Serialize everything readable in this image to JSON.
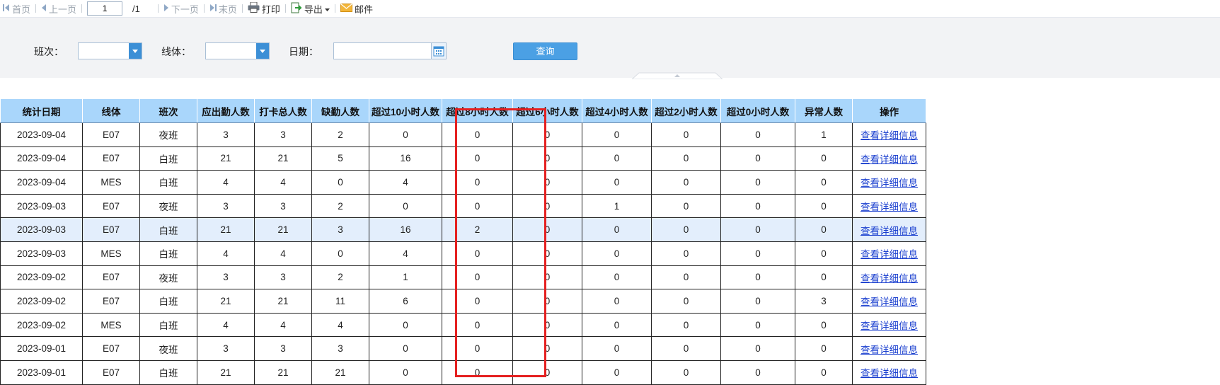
{
  "toolbar": {
    "first": "首页",
    "prev": "上一页",
    "page_value": "1",
    "page_total": "/1",
    "next": "下一页",
    "last": "末页",
    "print": "打印",
    "export": "导出",
    "mail": "邮件"
  },
  "filters": {
    "shift_label": "班次：",
    "line_label": "线体：",
    "date_label": "日期：",
    "query_button": "查询"
  },
  "colors": {
    "header_bg": "#a9d6fb",
    "accent": "#3c8fd6",
    "highlight_box": "#e52020",
    "selected_row": "#e3eefc"
  },
  "table": {
    "columns": [
      "统计日期",
      "线体",
      "班次",
      "应出勤人数",
      "打卡总人数",
      "缺勤人数",
      "超过10小时人数",
      "超过8小时人数",
      "超过6小时人数",
      "超过4小时人数",
      "超过2小时人数",
      "超过0小时人数",
      "异常人数",
      "操作"
    ],
    "action_label": "查看详细信息",
    "rows": [
      [
        "2023-09-04",
        "E07",
        "夜班",
        "3",
        "3",
        "2",
        "0",
        "0",
        "0",
        "0",
        "0",
        "0",
        "1"
      ],
      [
        "2023-09-04",
        "E07",
        "白班",
        "21",
        "21",
        "5",
        "16",
        "0",
        "0",
        "0",
        "0",
        "0",
        "0"
      ],
      [
        "2023-09-04",
        "MES",
        "白班",
        "4",
        "4",
        "0",
        "4",
        "0",
        "0",
        "0",
        "0",
        "0",
        "0"
      ],
      [
        "2023-09-03",
        "E07",
        "夜班",
        "3",
        "3",
        "2",
        "0",
        "0",
        "0",
        "1",
        "0",
        "0",
        "0"
      ],
      [
        "2023-09-03",
        "E07",
        "白班",
        "21",
        "21",
        "3",
        "16",
        "2",
        "0",
        "0",
        "0",
        "0",
        "0"
      ],
      [
        "2023-09-03",
        "MES",
        "白班",
        "4",
        "4",
        "0",
        "4",
        "0",
        "0",
        "0",
        "0",
        "0",
        "0"
      ],
      [
        "2023-09-02",
        "E07",
        "夜班",
        "3",
        "3",
        "2",
        "1",
        "0",
        "0",
        "0",
        "0",
        "0",
        "0"
      ],
      [
        "2023-09-02",
        "E07",
        "白班",
        "21",
        "21",
        "11",
        "6",
        "0",
        "0",
        "0",
        "0",
        "0",
        "3"
      ],
      [
        "2023-09-02",
        "MES",
        "白班",
        "4",
        "4",
        "4",
        "0",
        "0",
        "0",
        "0",
        "0",
        "0",
        "0"
      ],
      [
        "2023-09-01",
        "E07",
        "夜班",
        "3",
        "3",
        "3",
        "0",
        "0",
        "0",
        "0",
        "0",
        "0",
        "0"
      ],
      [
        "2023-09-01",
        "E07",
        "白班",
        "21",
        "21",
        "21",
        "0",
        "0",
        "0",
        "0",
        "0",
        "0",
        "0"
      ]
    ],
    "selected_row": 4
  }
}
